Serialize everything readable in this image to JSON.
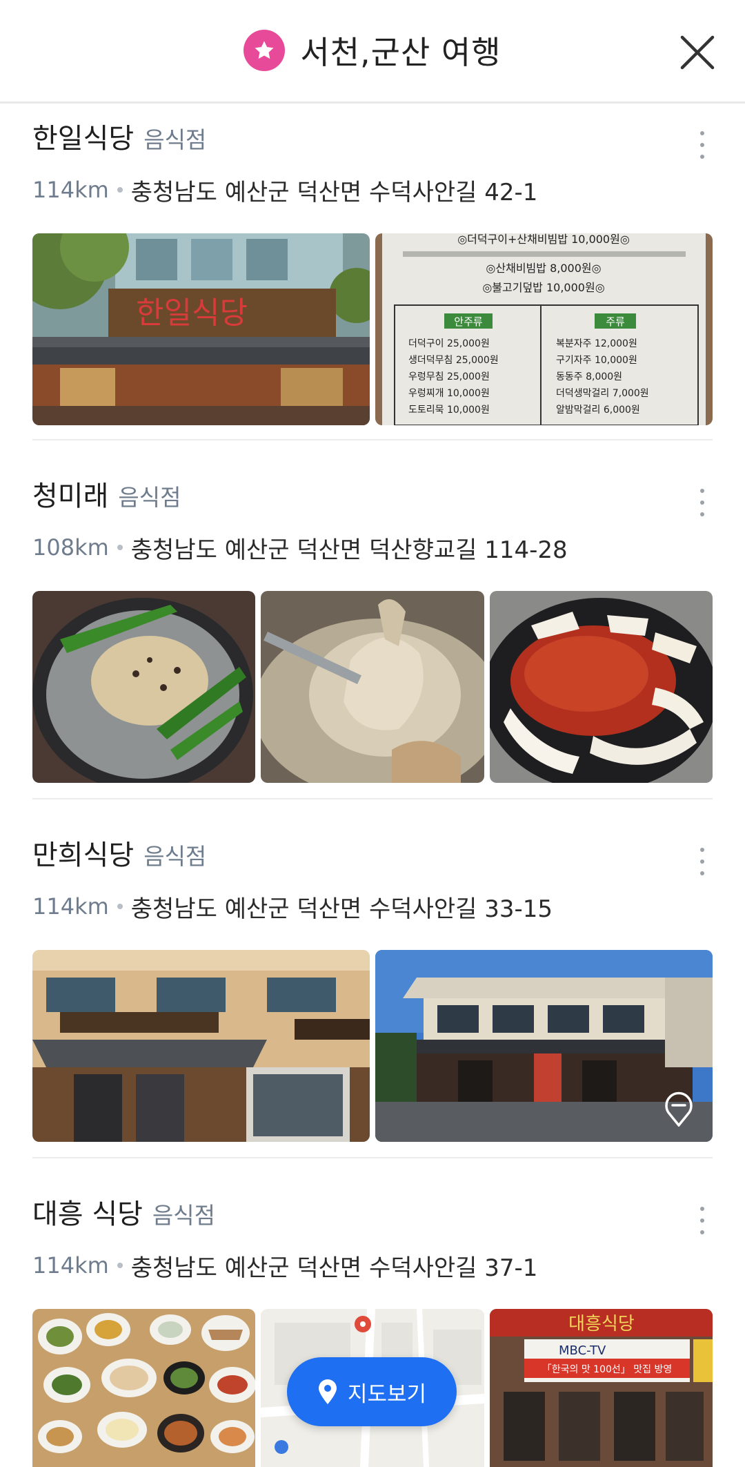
{
  "header": {
    "title": "서천,군산 여행",
    "badge_icon": "star-icon",
    "close_icon": "close-icon",
    "badge_color": "#e84a9a"
  },
  "places": [
    {
      "name": "한일식당",
      "category": "음식점",
      "distance": "114km",
      "address": "충청남도 예산군 덕산면 수덕사안길 42-1",
      "photos": [
        "storefront-sign",
        "menu-board"
      ],
      "sign_text": "한일식당",
      "menu_header": "◎더덕구이+산채비빔밥 10,000원◎",
      "menu_items": [
        "◎산채비빔밥 8,000원◎",
        "◎불고기덮밥 10,000원◎"
      ],
      "menu_col1_title": "안주류",
      "menu_col2_title": "주류",
      "menu_col1": [
        "더덕구이 25,000원",
        "생더덕무침 25,000원",
        "우렁무침 25,000원",
        "우렁찌개 10,000원",
        "도토리묵 10,000원"
      ],
      "menu_col2": [
        "복분자주 12,000원",
        "구기자주 10,000원",
        "동동주 8,000원",
        "더덕생막걸리 7,000원",
        "알밤막걸리 6,000원"
      ]
    },
    {
      "name": "청미래",
      "category": "음식점",
      "distance": "108km",
      "address": "충청남도 예산군 덕산면 덕산향교길 114-28",
      "photos": [
        "chicken-hotpot",
        "boiled-chicken",
        "spicy-stir-fry"
      ]
    },
    {
      "name": "만희식당",
      "category": "음식점",
      "distance": "114km",
      "address": "충청남도 예산군 덕산면 수덕사안길 33-15",
      "photos": [
        "building-front",
        "building-street"
      ]
    },
    {
      "name": "대흥 식당",
      "category": "음식점",
      "distance": "114km",
      "address": "충청남도 예산군 덕산면 수덕사안길 37-1",
      "photos": [
        "table-spread",
        "map-thumbnail",
        "restaurant-sign"
      ],
      "sign_text": "대흥식당",
      "tv_text": "MBC-TV",
      "banner_text": "「한국의 맛 100선」 맛집 방영"
    }
  ],
  "map_button": {
    "label": "지도보기",
    "icon": "location-pin-icon",
    "color": "#1f6ff2"
  }
}
